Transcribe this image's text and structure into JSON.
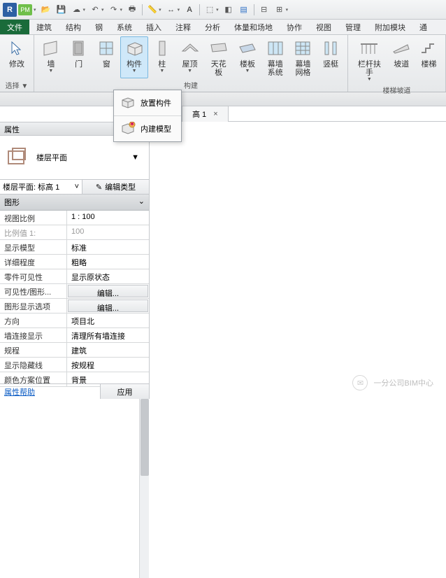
{
  "qat": {
    "app_icon": "R",
    "pm_icon": "PM"
  },
  "menu": {
    "file": "文件",
    "arch": "建筑",
    "struct": "结构",
    "steel": "钢",
    "sys": "系统",
    "insert": "插入",
    "annot": "注释",
    "analyze": "分析",
    "mass": "体量和场地",
    "collab": "协作",
    "view": "视图",
    "manage": "管理",
    "addins": "附加模块",
    "more": "通"
  },
  "ribbon": {
    "modify": "修改",
    "wall": "墙",
    "door": "门",
    "window": "窗",
    "component": "构件",
    "column": "柱",
    "roof": "屋顶",
    "ceiling": "天花板",
    "floor": "楼板",
    "curtain_sys": "幕墙\n系统",
    "curtain_grid": "幕墙\n网格",
    "mullion": "竖梃",
    "railing": "栏杆扶手",
    "ramp": "坡道",
    "stair": "楼梯",
    "select_label": "选择 ▼",
    "build_label": "构建",
    "circ_label": "楼梯坡道"
  },
  "dropdown": {
    "place": "放置构件",
    "inplace": "内建模型"
  },
  "tab": {
    "name": "高 1",
    "close": "×"
  },
  "props": {
    "header": "属性",
    "type_name": "楼层平面",
    "instance": "楼层平面: 标高 1",
    "edit_type": "编辑类型",
    "group_graphics": "图形",
    "rows": [
      {
        "l": "视图比例",
        "v": "1 : 100"
      },
      {
        "l": "比例值 1:",
        "v": "100",
        "dim": true
      },
      {
        "l": "显示模型",
        "v": "标准"
      },
      {
        "l": "详细程度",
        "v": "粗略"
      },
      {
        "l": "零件可见性",
        "v": "显示原状态"
      },
      {
        "l": "可见性/图形...",
        "v": "编辑...",
        "btn": true
      },
      {
        "l": "图形显示选项",
        "v": "编辑...",
        "btn": true
      },
      {
        "l": "方向",
        "v": "项目北"
      },
      {
        "l": "墙连接显示",
        "v": "清理所有墙连接"
      },
      {
        "l": "规程",
        "v": "建筑"
      },
      {
        "l": "显示隐藏线",
        "v": "按规程"
      },
      {
        "l": "颜色方案位置",
        "v": "背景"
      }
    ],
    "help": "属性帮助",
    "apply": "应用"
  },
  "watermark": "一分公司BIM中心"
}
